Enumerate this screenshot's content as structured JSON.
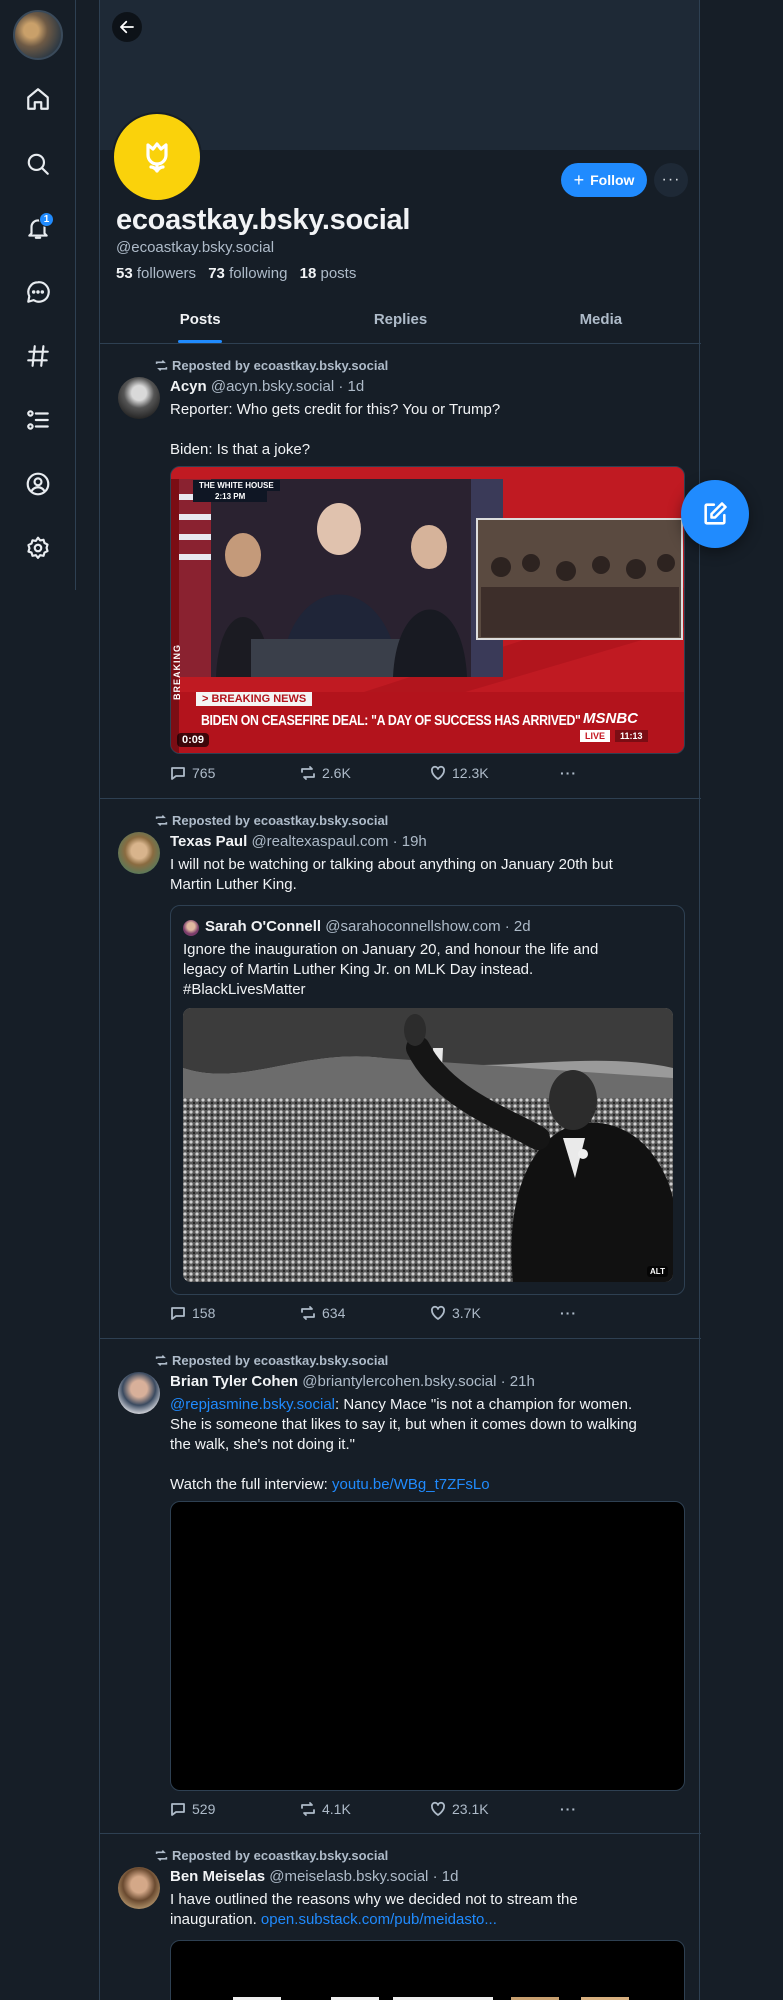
{
  "nav": {
    "badge": "1",
    "items": [
      "home-icon",
      "search-icon",
      "notifications-icon",
      "chat-icon",
      "feeds-icon",
      "lists-icon",
      "profile-icon",
      "settings-icon"
    ]
  },
  "profile": {
    "display_name": "ecoastkay.bsky.social",
    "handle": "@ecoastkay.bsky.social",
    "followers_count": "53",
    "followers_label": "followers",
    "following_count": "73",
    "following_label": "following",
    "posts_count": "18",
    "posts_label": "posts",
    "follow_label": "Follow",
    "avatar_color": "#fad20b"
  },
  "tabs": [
    {
      "label": "Posts",
      "active": true
    },
    {
      "label": "Replies",
      "active": false
    },
    {
      "label": "Media",
      "active": false
    }
  ],
  "colors": {
    "accent": "#208bfe",
    "background": "#161e27",
    "border": "#2e4052"
  },
  "posts": [
    {
      "repost_label": "Reposted by ecoastkay.bsky.social",
      "author": "Acyn",
      "handle": "@acyn.bsky.social",
      "time": "· 1d",
      "text_line1": "Reporter: Who gets credit for this? You or Trump?",
      "text_line2": "Biden: Is that a joke?",
      "video": {
        "chyron_top": "THE WHITE HOUSE",
        "chyron_time": "2:13 PM",
        "breaking": "> BREAKING NEWS",
        "headline": "BIDEN ON CEASEFIRE DEAL: \"A DAY OF SUCCESS HAS ARRIVED\"",
        "side_label": "BREAKING",
        "network": "MSNBC",
        "live": "LIVE",
        "clock": "11:13",
        "duration": "0:09"
      },
      "replies": "765",
      "reposts": "2.6K",
      "likes": "12.3K"
    },
    {
      "repost_label": "Reposted by ecoastkay.bsky.social",
      "author": "Texas Paul",
      "handle": "@realtexaspaul.com",
      "time": "· 19h",
      "text_line1": "I will not be watching or talking about anything on January 20th but",
      "text_line2": "Martin Luther King.",
      "quote": {
        "author": "Sarah O'Connell",
        "handle": "@sarahoconnellshow.com",
        "time": "· 2d",
        "line1": "Ignore the inauguration on January 20, and honour the life and",
        "line2": "legacy of Martin Luther King Jr. on MLK Day instead.",
        "line3": "#BlackLivesMatter",
        "alt_badge": "ALT"
      },
      "replies": "158",
      "reposts": "634",
      "likes": "3.7K"
    },
    {
      "repost_label": "Reposted by ecoastkay.bsky.social",
      "author": "Brian Tyler Cohen",
      "handle": "@briantylercohen.bsky.social",
      "time": "· 21h",
      "mention": "@repjasmine.bsky.social",
      "text_line1_rest": ": Nancy Mace \"is not a champion for women.",
      "text_line2": "She is someone that likes to say it, but when it comes down to walking",
      "text_line3": "the walk, she's not doing it.\"",
      "text_line4_prefix": "Watch the full interview: ",
      "link": "youtu.be/WBg_t7ZFsLo",
      "replies": "529",
      "reposts": "4.1K",
      "likes": "23.1K"
    },
    {
      "repost_label": "Reposted by ecoastkay.bsky.social",
      "author": "Ben Meiselas",
      "handle": "@meiselasb.bsky.social",
      "time": "· 1d",
      "text_line1": "I have outlined the reasons why we decided not to stream the",
      "text_line2_prefix": "inauguration. ",
      "link": "open.substack.com/pub/meidasto..."
    }
  ]
}
